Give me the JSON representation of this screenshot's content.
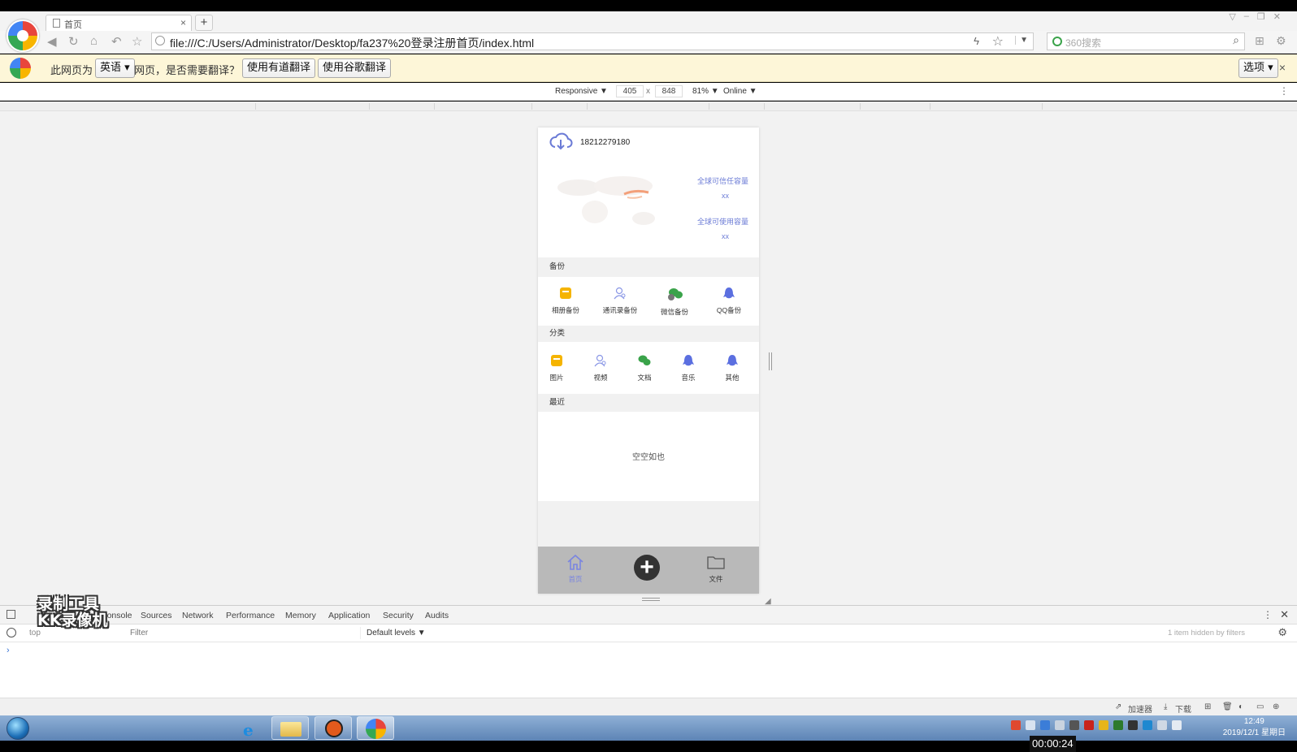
{
  "browser": {
    "tab_title": "首页",
    "tab_close": "×",
    "new_tab": "+",
    "url": "file:///C:/Users/Administrator/Desktop/fa237%20登录注册首页/index.html",
    "search_placeholder": "360搜索"
  },
  "translate_bar": {
    "prefix": "此网页为",
    "language": "英语",
    "question": "网页，是否需要翻译？",
    "youdao_button": "使用有道翻译",
    "google_button": "使用谷歌翻译",
    "options_button": "选项",
    "close": "×"
  },
  "device_toolbar": {
    "mode": "Responsive ▼",
    "width": "405",
    "separator": "x",
    "height": "848",
    "zoom": "81% ▼",
    "network": "Online ▼"
  },
  "app": {
    "phone_number": "18212279180",
    "trusted_capacity_label": "全球可信任容量",
    "trusted_capacity_value": "xx",
    "usable_capacity_label": "全球可使用容量",
    "usable_capacity_value": "xx",
    "backup_section": "备份",
    "backup_items": [
      "相册备份",
      "通讯录备份",
      "微信备份",
      "QQ备份"
    ],
    "category_section": "分类",
    "category_items": [
      "图片",
      "视频",
      "文档",
      "音乐",
      "其他"
    ],
    "recent_section": "最近",
    "empty_text": "空空如也",
    "nav": {
      "home": "首页",
      "files": "文件"
    },
    "accent_color": "#6b7bd6",
    "colors": {
      "album": "#f5b400",
      "wechat": "#3aa34a",
      "qq": "#5b6fe0"
    }
  },
  "devtools": {
    "tabs": [
      "Console",
      "Sources",
      "Network",
      "Performance",
      "Memory",
      "Application",
      "Security",
      "Audits"
    ],
    "context": "top",
    "filter_placeholder": "Filter",
    "levels": "Default levels ▼",
    "hidden_note": "1 item hidden by filters",
    "prompt": "›"
  },
  "statusbar": {
    "accelerator": "加速器",
    "download": "下载"
  },
  "taskbar": {
    "time": "12:49",
    "date": "2019/12/1 星期日"
  },
  "overlay": {
    "watermark_line1": "录制工具",
    "watermark_line2": "KK录像机",
    "recording_timer": "00:00:24"
  }
}
